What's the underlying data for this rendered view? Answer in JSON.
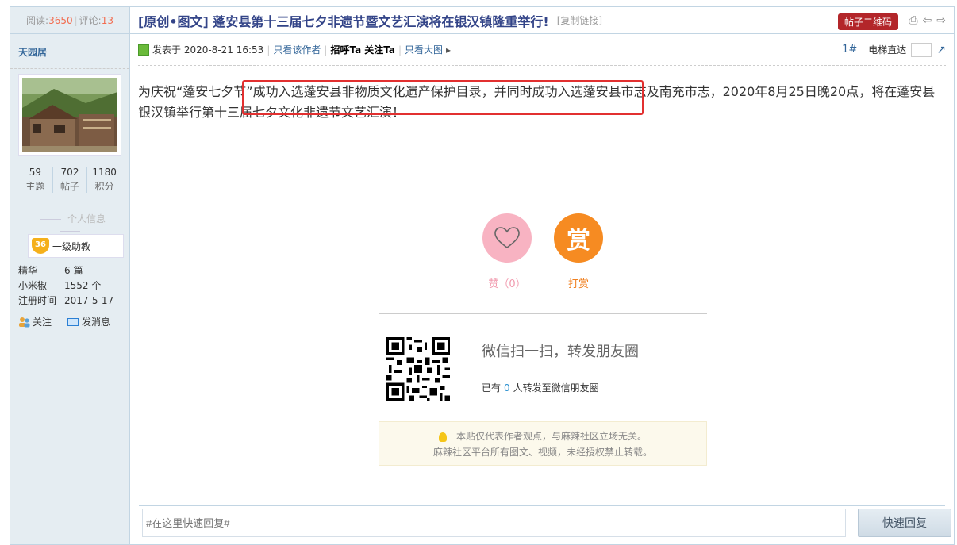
{
  "stats": {
    "read_label": "阅读:",
    "read_count": "3650",
    "comment_label": "评论:",
    "comment_count": "13"
  },
  "thread": {
    "title": "[原创•图文] 蓬安县第十三届七夕非遗节暨文艺汇演将在银汉镇隆重举行!",
    "copy_link": "[复制链接]",
    "qr_button": "帖子二维码"
  },
  "author": {
    "name": "天园居",
    "counts": [
      {
        "value": "59",
        "label": "主题"
      },
      {
        "value": "702",
        "label": "帖子"
      },
      {
        "value": "1180",
        "label": "积分"
      }
    ],
    "section_title": "个人信息",
    "rank_num": "36",
    "rank_title": "一级助教",
    "info": [
      {
        "key": "精华",
        "value": "6 篇"
      },
      {
        "key": "小米椒",
        "value": "1552 个"
      },
      {
        "key": "注册时间",
        "value": "2017-5-17"
      }
    ],
    "follow_label": "关注",
    "message_label": "发消息"
  },
  "meta": {
    "posted": "发表于 2020-8-21 16:53",
    "only_author": "只看该作者",
    "greet": "招呼Ta",
    "follow": "关注Ta",
    "big_image": "只看大图",
    "floor": "1#",
    "jump_label": "电梯直达"
  },
  "post": {
    "text": "为庆祝“蓬安七夕节”成功入选蓬安县非物质文化遗产保护目录，并同时成功入选蓬安县市志及南充市志，2020年8月25日晚20点，将在蓬安县银汉镇举行第十三届七夕文化非遗节文艺汇演！"
  },
  "actions": {
    "like_label": "赞（0）",
    "reward_glyph": "赏",
    "reward_label": "打赏"
  },
  "wechat": {
    "title": "微信扫一扫，转发朋友圈",
    "sub_prefix": "已有",
    "sub_count": "0",
    "sub_suffix": "人转发至微信朋友圈"
  },
  "notice": {
    "line1": "本贴仅代表作者观点，与麻辣社区立场无关。",
    "line2": "麻辣社区平台所有图文、视频，未经授权禁止转载。"
  },
  "reply": {
    "placeholder": "#在这里快速回复#",
    "button": "快速回复"
  }
}
